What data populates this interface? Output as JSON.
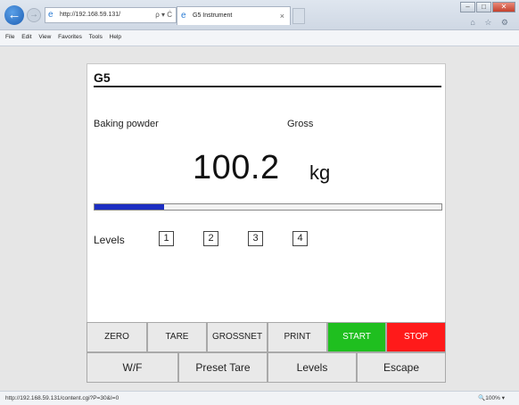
{
  "browser": {
    "address": "http://192.168.59.131/",
    "address_tools": "ρ ▾ Ċ",
    "tab_title": "G5 Instrument",
    "tab_close": "×",
    "menu": [
      "File",
      "Edit",
      "View",
      "Favorites",
      "Tools",
      "Help"
    ],
    "window_buttons": [
      "–",
      "□",
      "✕"
    ],
    "right_icons": "⌂ ☆ ⚙"
  },
  "instrument": {
    "title": "G5",
    "product": "Baking powder",
    "mode": "Gross",
    "weight": "100.2",
    "unit": "kg",
    "progress_fraction": 0.2,
    "levels_label": "Levels",
    "levels": [
      "1",
      "2",
      "3",
      "4"
    ]
  },
  "buttons_row1": [
    {
      "label": "ZERO",
      "bg": "#e9e9e9",
      "color": "#222222"
    },
    {
      "label": "TARE",
      "bg": "#e9e9e9",
      "color": "#222222"
    },
    {
      "label": "GROSSNET",
      "bg": "#e9e9e9",
      "color": "#222222"
    },
    {
      "label": "PRINT",
      "bg": "#e9e9e9",
      "color": "#222222"
    },
    {
      "label": "START",
      "bg": "#1fbf1f",
      "color": "#ffffff"
    },
    {
      "label": "STOP",
      "bg": "#ff1a1a",
      "color": "#ffffff"
    }
  ],
  "buttons_row2": [
    "W/F",
    "Preset Tare",
    "Levels",
    "Escape"
  ],
  "status": {
    "url": "http://192.168.59.131/content.cgi?P=30&I=0",
    "zoom": "🔍100% ▾"
  },
  "colors": {
    "progress": "#1c2ec2",
    "start": "#1fbf1f",
    "stop": "#ff1a1a"
  }
}
